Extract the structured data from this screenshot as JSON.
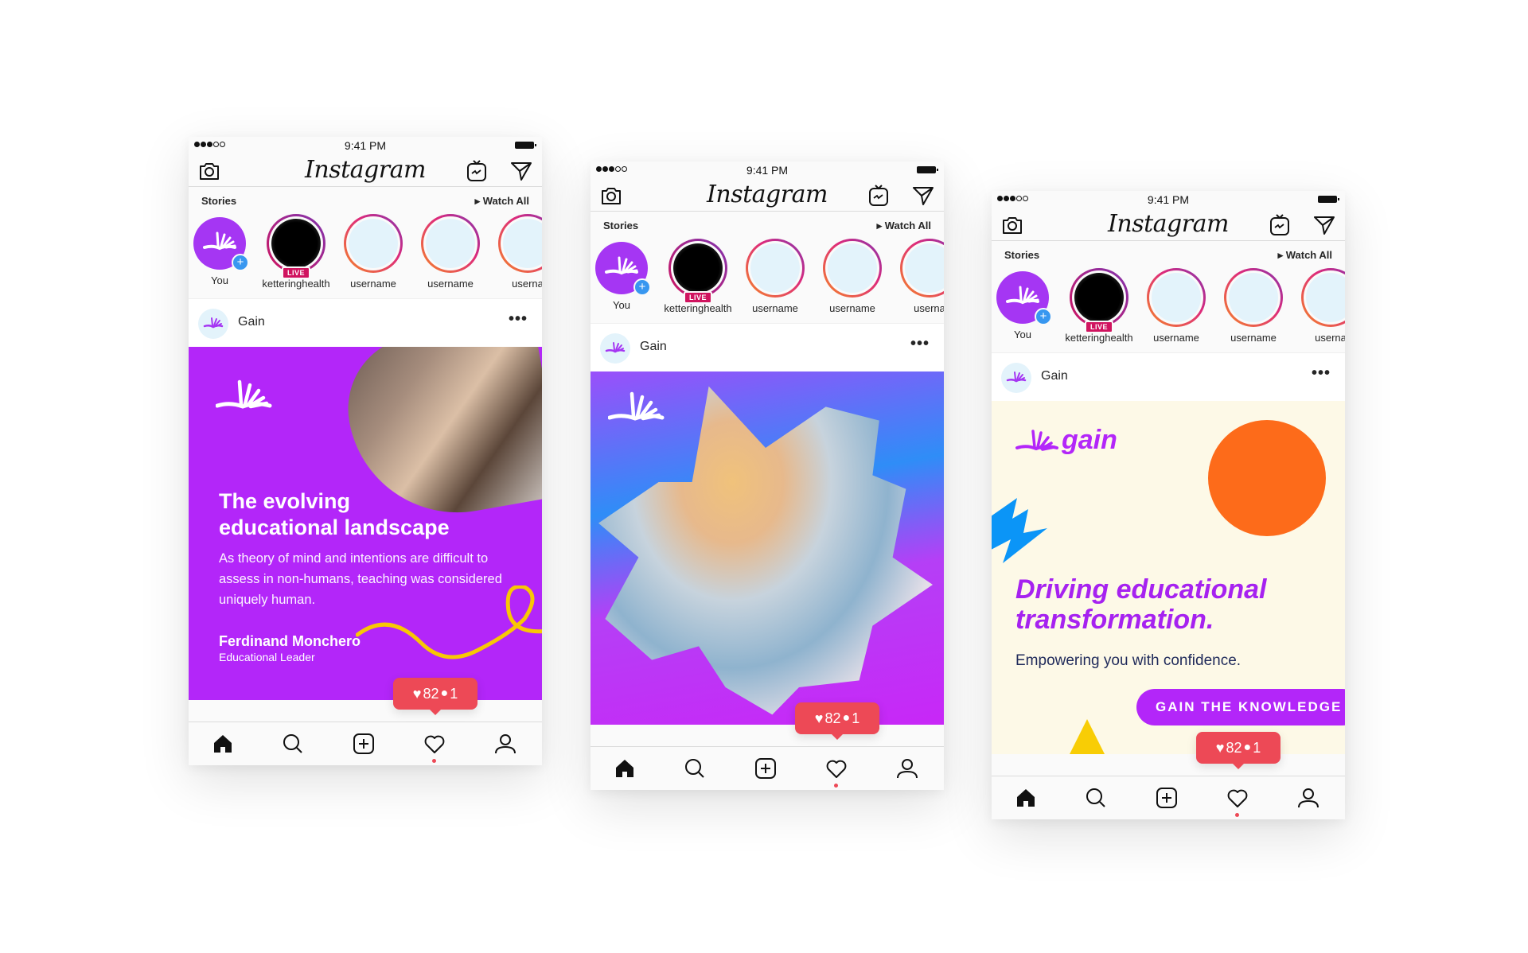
{
  "phones": [
    {
      "status": {
        "time": "9:41 PM"
      },
      "header": {
        "logo": "Instagram"
      },
      "stories": {
        "title": "Stories",
        "watch_all": "▸ Watch All",
        "items": [
          {
            "label": "You",
            "type": "self"
          },
          {
            "label": "ketteringhealth",
            "type": "live",
            "badge": "LIVE"
          },
          {
            "label": "username",
            "type": "normal"
          },
          {
            "label": "username",
            "type": "normal"
          },
          {
            "label": "userna",
            "type": "normal"
          }
        ]
      },
      "post": {
        "account": "Gain",
        "more": "•••",
        "title_line1": "The evolving",
        "title_line2": "educational landscape",
        "body": "As theory of mind and intentions are difficult to assess in non-humans, teaching was considered uniquely human.",
        "author": "Ferdinand Monchero",
        "role": "Educational Leader"
      },
      "notification": {
        "likes": "82",
        "comments": "1"
      }
    },
    {
      "status": {
        "time": "9:41 PM"
      },
      "header": {
        "logo": "Instagram"
      },
      "stories": {
        "title": "Stories",
        "watch_all": "▸ Watch All",
        "items": [
          {
            "label": "You",
            "type": "self"
          },
          {
            "label": "ketteringhealth",
            "type": "live",
            "badge": "LIVE"
          },
          {
            "label": "username",
            "type": "normal"
          },
          {
            "label": "username",
            "type": "normal"
          },
          {
            "label": "userna",
            "type": "normal"
          }
        ]
      },
      "post": {
        "account": "Gain",
        "more": "•••"
      },
      "notification": {
        "likes": "82",
        "comments": "1"
      }
    },
    {
      "status": {
        "time": "9:41 PM"
      },
      "header": {
        "logo": "Instagram"
      },
      "stories": {
        "title": "Stories",
        "watch_all": "▸ Watch All",
        "items": [
          {
            "label": "You",
            "type": "self"
          },
          {
            "label": "ketteringhealth",
            "type": "live",
            "badge": "LIVE"
          },
          {
            "label": "username",
            "type": "normal"
          },
          {
            "label": "username",
            "type": "normal"
          },
          {
            "label": "userna",
            "type": "normal"
          }
        ]
      },
      "post": {
        "account": "Gain",
        "more": "•••",
        "brand": "gain",
        "title_line1": "Driving educational",
        "title_line2": "transformation.",
        "subtitle": "Empowering you with confidence.",
        "cta": "GAIN THE KNOWLEDGE"
      },
      "notification": {
        "likes": "82",
        "comments": "1"
      }
    }
  ],
  "colors": {
    "brand_purple": "#b326f9",
    "notification_red": "#ed4956",
    "orange": "#fd6b1a",
    "blue": "#0b95f7",
    "yellow": "#f8cd05"
  }
}
